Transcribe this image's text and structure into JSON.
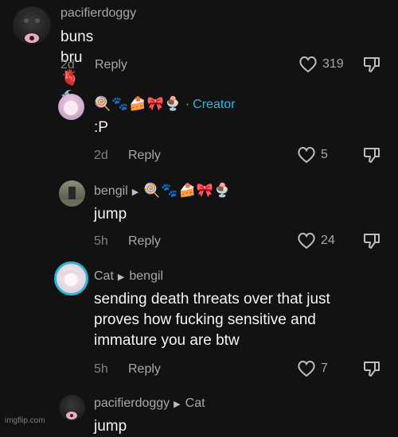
{
  "comments": [
    {
      "username": "pacifierdoggy",
      "text": "buns bru 🫀 🔨",
      "time": "2d",
      "reply_label": "Reply",
      "likes": "319"
    },
    {
      "username_emojis": "🍭🐾🍰🎀🍨",
      "creator_label": "Creator",
      "text": ":P",
      "time": "2d",
      "reply_label": "Reply",
      "likes": "5"
    },
    {
      "username": "bengil",
      "reply_to_emojis": "🍭🐾🍰🎀🍨",
      "text": "jump",
      "time": "5h",
      "reply_label": "Reply",
      "likes": "24"
    },
    {
      "username": "Cat",
      "reply_to": "bengil",
      "text": "sending death threats over that just proves how fucking sensitive and immature you are btw",
      "time": "5h",
      "reply_label": "Reply",
      "likes": "7"
    },
    {
      "username": "pacifierdoggy",
      "reply_to": "Cat",
      "text": "jump"
    }
  ],
  "watermark": "imgflip.com",
  "colors": {
    "background": "#121212",
    "creator": "#28b9e6",
    "muted": "#a8a8a8"
  }
}
